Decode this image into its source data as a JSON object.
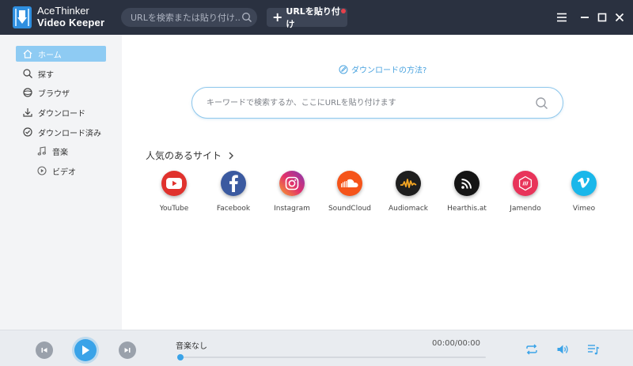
{
  "app": {
    "name_line1": "AceThinker",
    "name_line2": "Video Keeper",
    "brand_color": "#2a3140",
    "accent_color": "#3aa3e8"
  },
  "titlebar": {
    "search_placeholder": "URLを検索または貼り付け...",
    "paste_button_label": "URLを貼り付け",
    "paste_button_icon": "plus-icon",
    "window_controls": [
      "menu-icon",
      "minimize-icon",
      "maximize-icon",
      "close-icon"
    ]
  },
  "sidebar": {
    "items": [
      {
        "label": "ホーム",
        "icon": "home-icon",
        "active": true
      },
      {
        "label": "探す",
        "icon": "search-icon"
      },
      {
        "label": "ブラウザ",
        "icon": "browser-icon"
      },
      {
        "label": "ダウンロード",
        "icon": "download-icon"
      },
      {
        "label": "ダウンロード済み",
        "icon": "check-circle-icon"
      },
      {
        "label": "音楽",
        "icon": "music-note-icon",
        "sub": true
      },
      {
        "label": "ビデオ",
        "icon": "video-play-icon",
        "sub": true
      }
    ]
  },
  "main": {
    "howto_link": "ダウンロードの方法?",
    "search_placeholder": "キーワードで検索するか、ここにURLを貼り付けます",
    "popular_title": "人気のあるサイト"
  },
  "sites": [
    {
      "label": "YouTube",
      "icon": "youtube-icon",
      "color": "#e0322d"
    },
    {
      "label": "Facebook",
      "icon": "facebook-icon",
      "color": "#3b5aa0"
    },
    {
      "label": "Instagram",
      "icon": "instagram-icon",
      "color": "#c13584"
    },
    {
      "label": "SoundCloud",
      "icon": "soundcloud-icon",
      "color": "#f5541a"
    },
    {
      "label": "Audiomack",
      "icon": "audiomack-icon",
      "color": "#1f1f1f"
    },
    {
      "label": "Hearthis.at",
      "icon": "hearthis-icon",
      "color": "#151515"
    },
    {
      "label": "Jamendo",
      "icon": "jamendo-icon",
      "color": "#e8345a"
    },
    {
      "label": "Vimeo",
      "icon": "vimeo-icon",
      "color": "#1ab7ea"
    }
  ],
  "player": {
    "track": "音楽なし",
    "time": "00:00/00:00",
    "progress": 0,
    "buttons": [
      "previous-icon",
      "play-icon",
      "next-icon",
      "repeat-icon",
      "volume-icon",
      "playlist-icon"
    ]
  }
}
